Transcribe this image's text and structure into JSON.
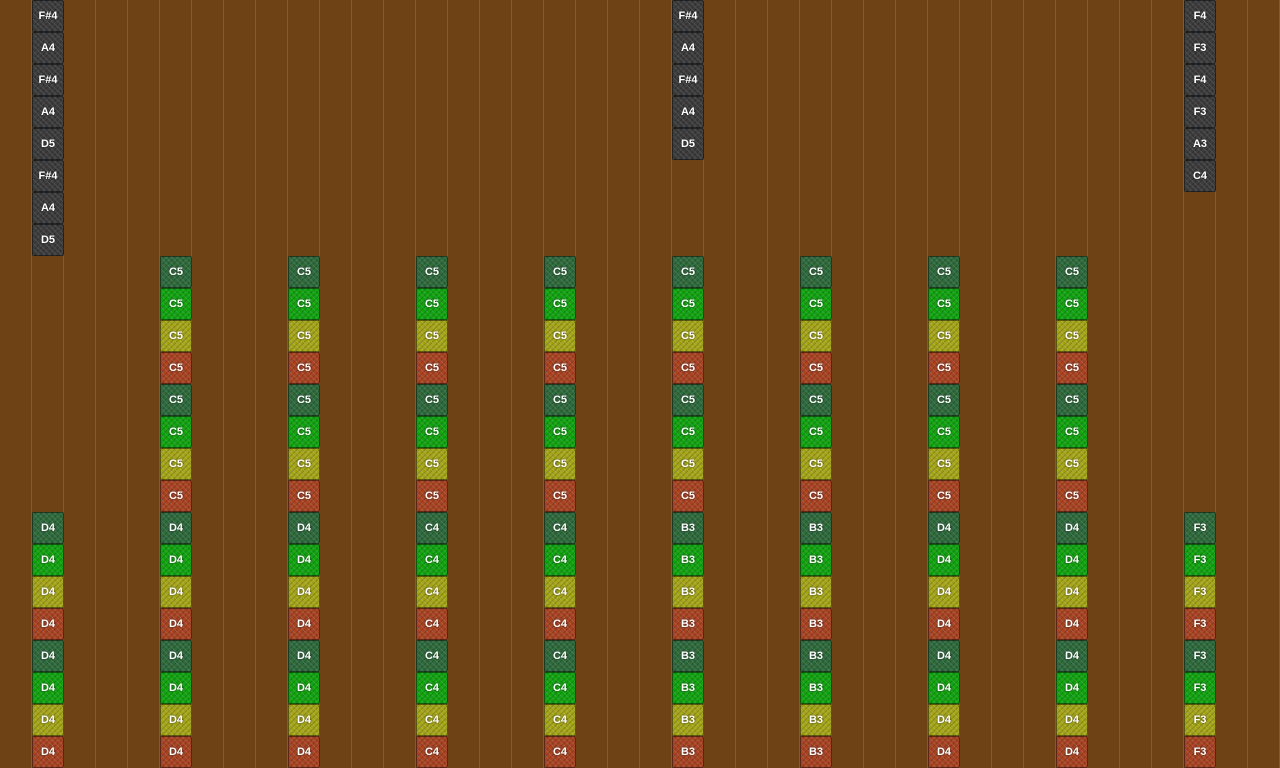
{
  "colors": {
    "background": "#6f4216",
    "gridline": "#9c7650",
    "dark": "#3c3c3c",
    "dgreen": "#2f6a3d",
    "green": "#13a312",
    "yellow": "#a5a51b",
    "red": "#a84424"
  },
  "columns": [
    {
      "blocks": [
        {
          "label": "F#4",
          "color": "dark",
          "row": 0
        },
        {
          "label": "A4",
          "color": "dark",
          "row": 1
        },
        {
          "label": "F#4",
          "color": "dark",
          "row": 2
        },
        {
          "label": "A4",
          "color": "dark",
          "row": 3
        },
        {
          "label": "D5",
          "color": "dark",
          "row": 4
        },
        {
          "label": "F#4",
          "color": "dark",
          "row": 5
        },
        {
          "label": "A4",
          "color": "dark",
          "row": 6
        },
        {
          "label": "D5",
          "color": "dark",
          "row": 7
        },
        {
          "label": "D4",
          "color": "dgreen",
          "row": 16
        },
        {
          "label": "D4",
          "color": "green",
          "row": 17
        },
        {
          "label": "D4",
          "color": "yellow",
          "row": 18
        },
        {
          "label": "D4",
          "color": "red",
          "row": 19
        },
        {
          "label": "D4",
          "color": "dgreen",
          "row": 20
        },
        {
          "label": "D4",
          "color": "green",
          "row": 21
        },
        {
          "label": "D4",
          "color": "yellow",
          "row": 22
        },
        {
          "label": "D4",
          "color": "red",
          "row": 23
        }
      ]
    },
    {
      "blocks": [
        {
          "label": "C5",
          "color": "dgreen",
          "row": 8
        },
        {
          "label": "C5",
          "color": "green",
          "row": 9
        },
        {
          "label": "C5",
          "color": "yellow",
          "row": 10
        },
        {
          "label": "C5",
          "color": "red",
          "row": 11
        },
        {
          "label": "C5",
          "color": "dgreen",
          "row": 12
        },
        {
          "label": "C5",
          "color": "green",
          "row": 13
        },
        {
          "label": "C5",
          "color": "yellow",
          "row": 14
        },
        {
          "label": "C5",
          "color": "red",
          "row": 15
        },
        {
          "label": "D4",
          "color": "dgreen",
          "row": 16
        },
        {
          "label": "D4",
          "color": "green",
          "row": 17
        },
        {
          "label": "D4",
          "color": "yellow",
          "row": 18
        },
        {
          "label": "D4",
          "color": "red",
          "row": 19
        },
        {
          "label": "D4",
          "color": "dgreen",
          "row": 20
        },
        {
          "label": "D4",
          "color": "green",
          "row": 21
        },
        {
          "label": "D4",
          "color": "yellow",
          "row": 22
        },
        {
          "label": "D4",
          "color": "red",
          "row": 23
        }
      ]
    },
    {
      "blocks": [
        {
          "label": "C5",
          "color": "dgreen",
          "row": 8
        },
        {
          "label": "C5",
          "color": "green",
          "row": 9
        },
        {
          "label": "C5",
          "color": "yellow",
          "row": 10
        },
        {
          "label": "C5",
          "color": "red",
          "row": 11
        },
        {
          "label": "C5",
          "color": "dgreen",
          "row": 12
        },
        {
          "label": "C5",
          "color": "green",
          "row": 13
        },
        {
          "label": "C5",
          "color": "yellow",
          "row": 14
        },
        {
          "label": "C5",
          "color": "red",
          "row": 15
        },
        {
          "label": "D4",
          "color": "dgreen",
          "row": 16
        },
        {
          "label": "D4",
          "color": "green",
          "row": 17
        },
        {
          "label": "D4",
          "color": "yellow",
          "row": 18
        },
        {
          "label": "D4",
          "color": "red",
          "row": 19
        },
        {
          "label": "D4",
          "color": "dgreen",
          "row": 20
        },
        {
          "label": "D4",
          "color": "green",
          "row": 21
        },
        {
          "label": "D4",
          "color": "yellow",
          "row": 22
        },
        {
          "label": "D4",
          "color": "red",
          "row": 23
        }
      ]
    },
    {
      "blocks": [
        {
          "label": "C5",
          "color": "dgreen",
          "row": 8
        },
        {
          "label": "C5",
          "color": "green",
          "row": 9
        },
        {
          "label": "C5",
          "color": "yellow",
          "row": 10
        },
        {
          "label": "C5",
          "color": "red",
          "row": 11
        },
        {
          "label": "C5",
          "color": "dgreen",
          "row": 12
        },
        {
          "label": "C5",
          "color": "green",
          "row": 13
        },
        {
          "label": "C5",
          "color": "yellow",
          "row": 14
        },
        {
          "label": "C5",
          "color": "red",
          "row": 15
        },
        {
          "label": "C4",
          "color": "dgreen",
          "row": 16
        },
        {
          "label": "C4",
          "color": "green",
          "row": 17
        },
        {
          "label": "C4",
          "color": "yellow",
          "row": 18
        },
        {
          "label": "C4",
          "color": "red",
          "row": 19
        },
        {
          "label": "C4",
          "color": "dgreen",
          "row": 20
        },
        {
          "label": "C4",
          "color": "green",
          "row": 21
        },
        {
          "label": "C4",
          "color": "yellow",
          "row": 22
        },
        {
          "label": "C4",
          "color": "red",
          "row": 23
        }
      ]
    },
    {
      "blocks": [
        {
          "label": "C5",
          "color": "dgreen",
          "row": 8
        },
        {
          "label": "C5",
          "color": "green",
          "row": 9
        },
        {
          "label": "C5",
          "color": "yellow",
          "row": 10
        },
        {
          "label": "C5",
          "color": "red",
          "row": 11
        },
        {
          "label": "C5",
          "color": "dgreen",
          "row": 12
        },
        {
          "label": "C5",
          "color": "green",
          "row": 13
        },
        {
          "label": "C5",
          "color": "yellow",
          "row": 14
        },
        {
          "label": "C5",
          "color": "red",
          "row": 15
        },
        {
          "label": "C4",
          "color": "dgreen",
          "row": 16
        },
        {
          "label": "C4",
          "color": "green",
          "row": 17
        },
        {
          "label": "C4",
          "color": "yellow",
          "row": 18
        },
        {
          "label": "C4",
          "color": "red",
          "row": 19
        },
        {
          "label": "C4",
          "color": "dgreen",
          "row": 20
        },
        {
          "label": "C4",
          "color": "green",
          "row": 21
        },
        {
          "label": "C4",
          "color": "yellow",
          "row": 22
        },
        {
          "label": "C4",
          "color": "red",
          "row": 23
        }
      ]
    },
    {
      "blocks": [
        {
          "label": "F#4",
          "color": "dark",
          "row": 0
        },
        {
          "label": "A4",
          "color": "dark",
          "row": 1
        },
        {
          "label": "F#4",
          "color": "dark",
          "row": 2
        },
        {
          "label": "A4",
          "color": "dark",
          "row": 3
        },
        {
          "label": "D5",
          "color": "dark",
          "row": 4
        },
        {
          "label": "C5",
          "color": "dgreen",
          "row": 8
        },
        {
          "label": "C5",
          "color": "green",
          "row": 9
        },
        {
          "label": "C5",
          "color": "yellow",
          "row": 10
        },
        {
          "label": "C5",
          "color": "red",
          "row": 11
        },
        {
          "label": "C5",
          "color": "dgreen",
          "row": 12
        },
        {
          "label": "C5",
          "color": "green",
          "row": 13
        },
        {
          "label": "C5",
          "color": "yellow",
          "row": 14
        },
        {
          "label": "C5",
          "color": "red",
          "row": 15
        },
        {
          "label": "B3",
          "color": "dgreen",
          "row": 16
        },
        {
          "label": "B3",
          "color": "green",
          "row": 17
        },
        {
          "label": "B3",
          "color": "yellow",
          "row": 18
        },
        {
          "label": "B3",
          "color": "red",
          "row": 19
        },
        {
          "label": "B3",
          "color": "dgreen",
          "row": 20
        },
        {
          "label": "B3",
          "color": "green",
          "row": 21
        },
        {
          "label": "B3",
          "color": "yellow",
          "row": 22
        },
        {
          "label": "B3",
          "color": "red",
          "row": 23
        }
      ]
    },
    {
      "blocks": [
        {
          "label": "C5",
          "color": "dgreen",
          "row": 8
        },
        {
          "label": "C5",
          "color": "green",
          "row": 9
        },
        {
          "label": "C5",
          "color": "yellow",
          "row": 10
        },
        {
          "label": "C5",
          "color": "red",
          "row": 11
        },
        {
          "label": "C5",
          "color": "dgreen",
          "row": 12
        },
        {
          "label": "C5",
          "color": "green",
          "row": 13
        },
        {
          "label": "C5",
          "color": "yellow",
          "row": 14
        },
        {
          "label": "C5",
          "color": "red",
          "row": 15
        },
        {
          "label": "B3",
          "color": "dgreen",
          "row": 16
        },
        {
          "label": "B3",
          "color": "green",
          "row": 17
        },
        {
          "label": "B3",
          "color": "yellow",
          "row": 18
        },
        {
          "label": "B3",
          "color": "red",
          "row": 19
        },
        {
          "label": "B3",
          "color": "dgreen",
          "row": 20
        },
        {
          "label": "B3",
          "color": "green",
          "row": 21
        },
        {
          "label": "B3",
          "color": "yellow",
          "row": 22
        },
        {
          "label": "B3",
          "color": "red",
          "row": 23
        }
      ]
    },
    {
      "blocks": [
        {
          "label": "C5",
          "color": "dgreen",
          "row": 8
        },
        {
          "label": "C5",
          "color": "green",
          "row": 9
        },
        {
          "label": "C5",
          "color": "yellow",
          "row": 10
        },
        {
          "label": "C5",
          "color": "red",
          "row": 11
        },
        {
          "label": "C5",
          "color": "dgreen",
          "row": 12
        },
        {
          "label": "C5",
          "color": "green",
          "row": 13
        },
        {
          "label": "C5",
          "color": "yellow",
          "row": 14
        },
        {
          "label": "C5",
          "color": "red",
          "row": 15
        },
        {
          "label": "D4",
          "color": "dgreen",
          "row": 16
        },
        {
          "label": "D4",
          "color": "green",
          "row": 17
        },
        {
          "label": "D4",
          "color": "yellow",
          "row": 18
        },
        {
          "label": "D4",
          "color": "red",
          "row": 19
        },
        {
          "label": "D4",
          "color": "dgreen",
          "row": 20
        },
        {
          "label": "D4",
          "color": "green",
          "row": 21
        },
        {
          "label": "D4",
          "color": "yellow",
          "row": 22
        },
        {
          "label": "D4",
          "color": "red",
          "row": 23
        }
      ]
    },
    {
      "blocks": [
        {
          "label": "C5",
          "color": "dgreen",
          "row": 8
        },
        {
          "label": "C5",
          "color": "green",
          "row": 9
        },
        {
          "label": "C5",
          "color": "yellow",
          "row": 10
        },
        {
          "label": "C5",
          "color": "red",
          "row": 11
        },
        {
          "label": "C5",
          "color": "dgreen",
          "row": 12
        },
        {
          "label": "C5",
          "color": "green",
          "row": 13
        },
        {
          "label": "C5",
          "color": "yellow",
          "row": 14
        },
        {
          "label": "C5",
          "color": "red",
          "row": 15
        },
        {
          "label": "D4",
          "color": "dgreen",
          "row": 16
        },
        {
          "label": "D4",
          "color": "green",
          "row": 17
        },
        {
          "label": "D4",
          "color": "yellow",
          "row": 18
        },
        {
          "label": "D4",
          "color": "red",
          "row": 19
        },
        {
          "label": "D4",
          "color": "dgreen",
          "row": 20
        },
        {
          "label": "D4",
          "color": "green",
          "row": 21
        },
        {
          "label": "D4",
          "color": "yellow",
          "row": 22
        },
        {
          "label": "D4",
          "color": "red",
          "row": 23
        }
      ]
    },
    {
      "blocks": [
        {
          "label": "F4",
          "color": "dark",
          "row": 0
        },
        {
          "label": "F3",
          "color": "dark",
          "row": 1
        },
        {
          "label": "F4",
          "color": "dark",
          "row": 2
        },
        {
          "label": "F3",
          "color": "dark",
          "row": 3
        },
        {
          "label": "A3",
          "color": "dark",
          "row": 4
        },
        {
          "label": "C4",
          "color": "dark",
          "row": 5
        },
        {
          "label": "F3",
          "color": "dgreen",
          "row": 16
        },
        {
          "label": "F3",
          "color": "green",
          "row": 17
        },
        {
          "label": "F3",
          "color": "yellow",
          "row": 18
        },
        {
          "label": "F3",
          "color": "red",
          "row": 19
        },
        {
          "label": "F3",
          "color": "dgreen",
          "row": 20
        },
        {
          "label": "F3",
          "color": "green",
          "row": 21
        },
        {
          "label": "F3",
          "color": "yellow",
          "row": 22
        },
        {
          "label": "F3",
          "color": "red",
          "row": 23
        }
      ]
    }
  ]
}
